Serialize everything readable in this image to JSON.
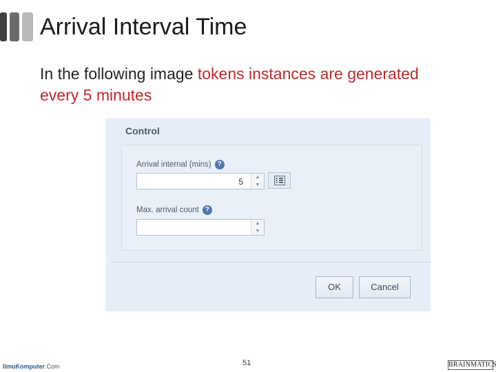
{
  "slide": {
    "title": "Arrival Interval Time",
    "body_plain": "In the following image ",
    "body_highlight": "tokens instances are generated every 5 minutes",
    "page_number": "51"
  },
  "dialog": {
    "title": "Control",
    "arrival_interval": {
      "label": "Arrival internal (mins)",
      "help": "?",
      "value": "5"
    },
    "max_arrival_count": {
      "label": "Max. arrival count",
      "help": "?",
      "value": ""
    },
    "ok_label": "OK",
    "cancel_label": "Cancel"
  },
  "footer": {
    "left_name": "IlmuKomputer",
    "left_domain": ".Com",
    "brand": "BRAINMATICS"
  },
  "colors": {
    "highlight": "#c0282b",
    "dialog_bg": "#e6eef7",
    "help_badge": "#4f77b0"
  },
  "icons": {
    "spin_up": "triangle-up-icon",
    "spin_down": "triangle-down-icon",
    "picker": "list-picker-icon",
    "help": "question-icon"
  }
}
